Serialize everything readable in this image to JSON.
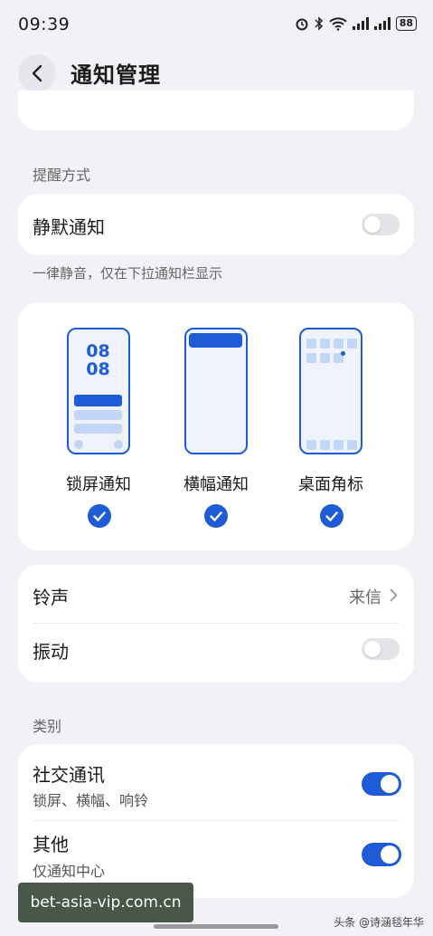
{
  "status_bar": {
    "time": "09:39",
    "battery": "88"
  },
  "header": {
    "title": "通知管理"
  },
  "sections": {
    "reminder": "提醒方式",
    "category": "类别"
  },
  "silent": {
    "label": "静默通知",
    "enabled": false,
    "hint": "一律静音，仅在下拉通知栏显示"
  },
  "styles": [
    {
      "label": "锁屏通知",
      "checked": true,
      "clock": [
        "08",
        "08"
      ]
    },
    {
      "label": "横幅通知",
      "checked": true
    },
    {
      "label": "桌面角标",
      "checked": true
    }
  ],
  "sound": {
    "ringtone_label": "铃声",
    "ringtone_value": "来信",
    "vibration_label": "振动",
    "vibration_enabled": false
  },
  "categories": [
    {
      "title": "社交通讯",
      "subtitle": "锁屏、横幅、响铃",
      "enabled": true
    },
    {
      "title": "其他",
      "subtitle": "仅通知中心",
      "enabled": true
    }
  ],
  "watermark": "bet-asia-vip.com.cn",
  "credit": "头条 @诗涵毯年华",
  "colors": {
    "accent": "#1e5bd6",
    "background": "#f1f2f6"
  }
}
